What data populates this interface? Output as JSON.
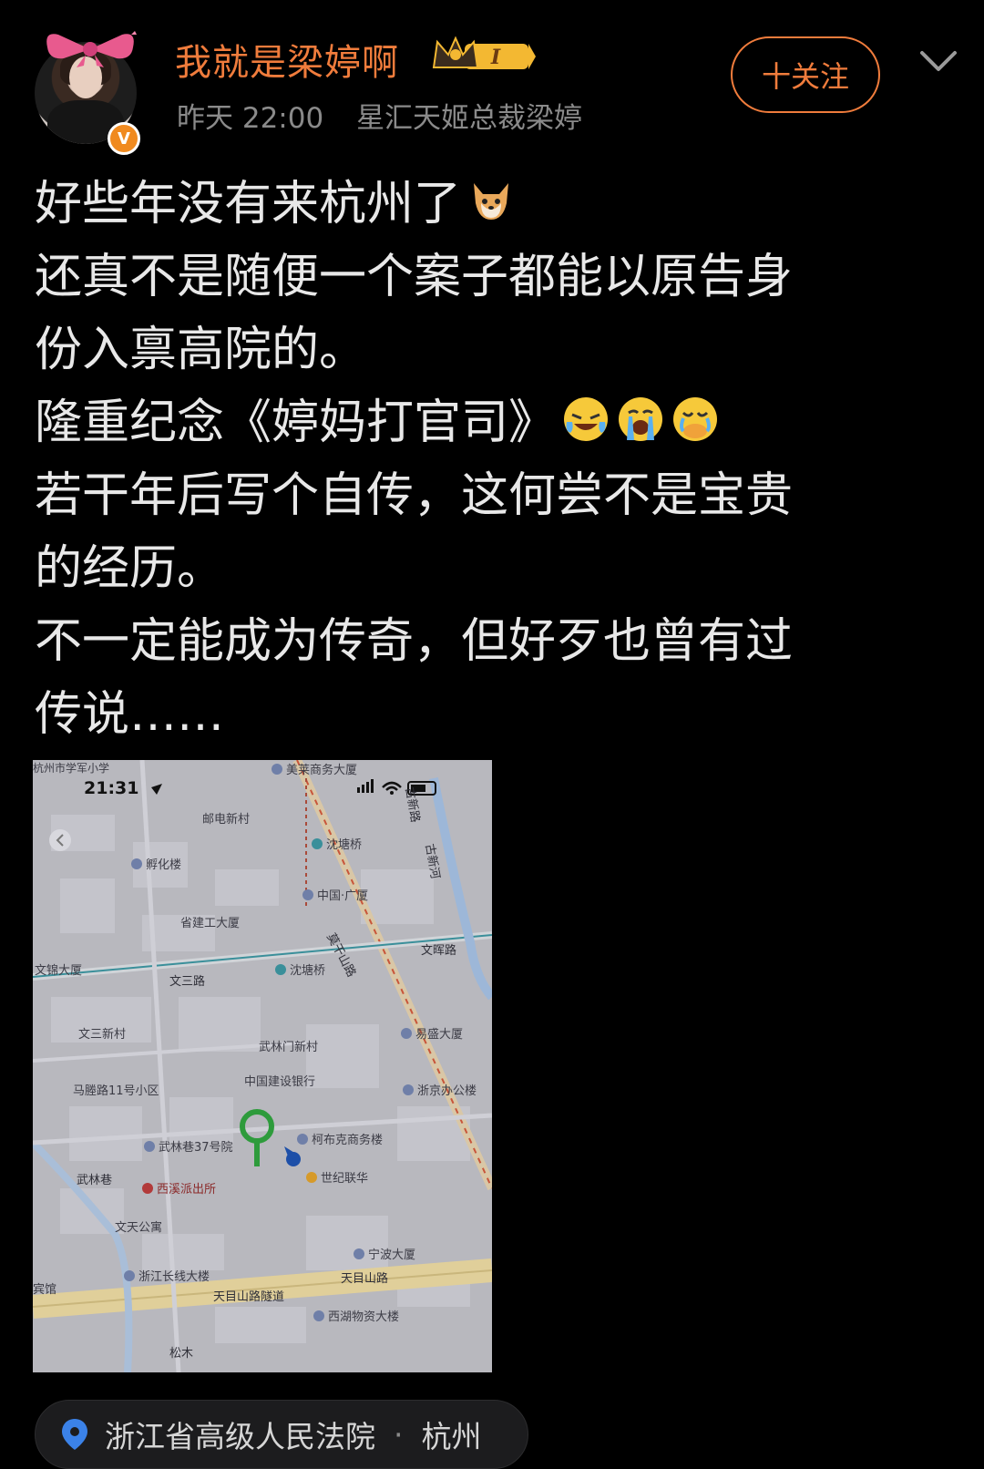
{
  "header": {
    "username": "我就是梁婷啊",
    "level_badge": "I",
    "time": "昨天 22:00",
    "source": "星汇天姬总裁梁婷",
    "follow_label": "十关注",
    "verified_mark": "V"
  },
  "post": {
    "lines": [
      "好些年没有来杭州了",
      "还真不是随便一个案子都能以原告身",
      "份入禀高院的。",
      "隆重纪念《婷妈打官司》",
      "若干年后写个自传，这何尝不是宝贵",
      "的经历。",
      "不一定能成为传奇，但好歹也曾有过",
      "传说……"
    ],
    "emojis": [
      "dog-face",
      "laugh-cry",
      "loud-cry",
      "cover-mouth-cry"
    ]
  },
  "map": {
    "status_time": "21:31",
    "top_label": "杭州市学军小学",
    "labels": {
      "meibao": "美莱商务大厦",
      "youdian": "邮电新村",
      "shentang_top": "沈塘桥",
      "fuhua": "孵化楼",
      "zhongguo_guangsha": "中国·广厦",
      "shengjiangong": "省建工大厦",
      "wenjin": "文锦大厦",
      "shentang_mid": "沈塘桥",
      "wensan": "文三路",
      "wenhui": "文晖路",
      "wensanxincun": "文三新村",
      "wulinmen": "武林门新村",
      "yisheng": "易盛大厦",
      "jianshe": "中国建设银行",
      "malu": "马塍路11号小区",
      "zhejing": "浙京办公楼",
      "kebuke": "柯布克商务楼",
      "wulinxiang37": "武林巷37号院",
      "wulinxiang": "武林巷",
      "xixi": "西溪派出所",
      "shijilianhua": "世纪联华",
      "wentian": "文天公寓",
      "ningbo": "宁波大厦",
      "zhejiangchangxian": "浙江长线大楼",
      "binguan": "宾馆",
      "tianmushan": "天目山路",
      "tianmushan_tunnel": "天目山路隧道",
      "xihu": "西湖物资大楼",
      "moganshan": "莫干山路",
      "guxin": "古新河",
      "guxin_road": "古新路",
      "song": "松木"
    }
  },
  "location": {
    "place": "浙江省高级人民法院",
    "city": "杭州",
    "separator": "·"
  },
  "colors": {
    "accent": "#f07c3c",
    "background": "#000000",
    "map_bg": "#b9b9bf",
    "pin_green": "#2e9b3c"
  }
}
